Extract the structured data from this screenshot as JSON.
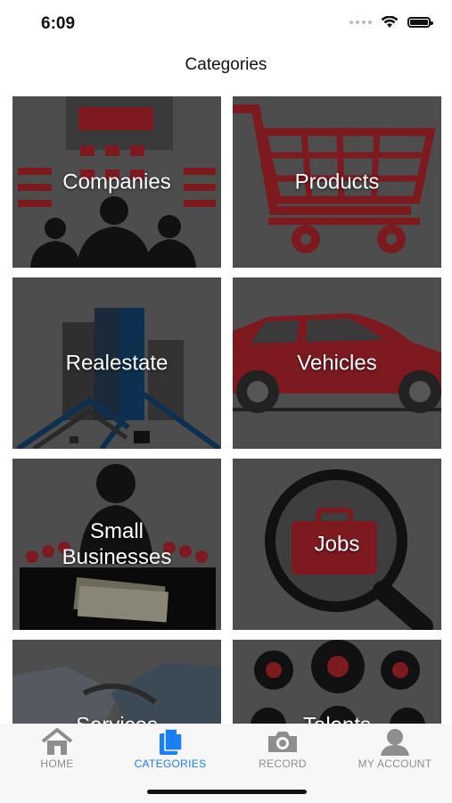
{
  "status": {
    "time": "6:09"
  },
  "header": {
    "title": "Categories"
  },
  "categories": [
    {
      "label": "Companies"
    },
    {
      "label": "Products"
    },
    {
      "label": "Realestate"
    },
    {
      "label": "Vehicles"
    },
    {
      "label": "Small\nBusinesses"
    },
    {
      "label": "Jobs"
    },
    {
      "label": "Services"
    },
    {
      "label": "Talents"
    }
  ],
  "tabs": [
    {
      "label": "HOME",
      "icon": "house-icon"
    },
    {
      "label": "CATEGORIES",
      "icon": "document-icon",
      "active": true
    },
    {
      "label": "RECORD",
      "icon": "camera-icon"
    },
    {
      "label": "MY ACCOUNT",
      "icon": "person-icon"
    }
  ],
  "colors": {
    "accent": "#1a7ff5",
    "tile_bg": "#4d4d4d",
    "icon_red": "#8b1a22"
  }
}
